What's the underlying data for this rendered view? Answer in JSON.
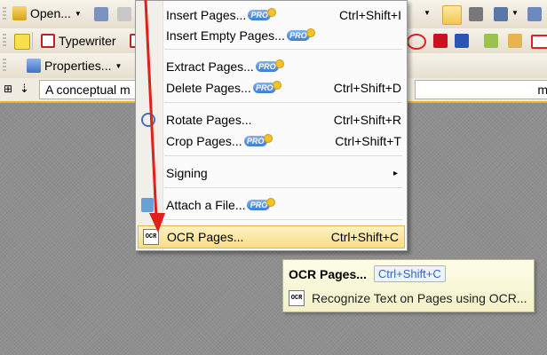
{
  "toolbar_top": {
    "open_label": "Open..."
  },
  "toolbar_comment": {
    "typewriter_label": "Typewriter"
  },
  "toolbar_props": {
    "properties_label": "Properties..."
  },
  "docbar": {
    "doc_title": "A conceptual m",
    "search_value": "",
    "search_trailing_char": "m"
  },
  "menu": {
    "items": [
      {
        "label": "Insert Pages...",
        "shortcut": "Ctrl+Shift+I",
        "pro": true
      },
      {
        "label": "Insert Empty Pages...",
        "shortcut": "",
        "pro": true
      },
      {
        "label": "Extract Pages...",
        "shortcut": "",
        "pro": true
      },
      {
        "label": "Delete Pages...",
        "shortcut": "Ctrl+Shift+D",
        "pro": true
      },
      {
        "label": "Rotate Pages...",
        "shortcut": "Ctrl+Shift+R",
        "pro": false
      },
      {
        "label": "Crop Pages...",
        "shortcut": "Ctrl+Shift+T",
        "pro": true
      },
      {
        "label": "Signing",
        "shortcut": "",
        "pro": false
      },
      {
        "label": "Attach a File...",
        "shortcut": "",
        "pro": true
      },
      {
        "label": "OCR Pages...",
        "shortcut": "Ctrl+Shift+C",
        "pro": false
      }
    ],
    "pro_badge": "PRO",
    "submenu_arrow": "▸"
  },
  "tooltip": {
    "title": "OCR Pages...",
    "shortcut": "Ctrl+Shift+C",
    "description": "Recognize Text on Pages using OCR..."
  },
  "icons": {
    "ocr_icon_text": "OCR"
  },
  "colors": {
    "highlight": "#f8dd85",
    "arrow": "#e0201a",
    "pro_badge": "#3e7fd1",
    "tooltip_bg": "#f8f7d4"
  }
}
